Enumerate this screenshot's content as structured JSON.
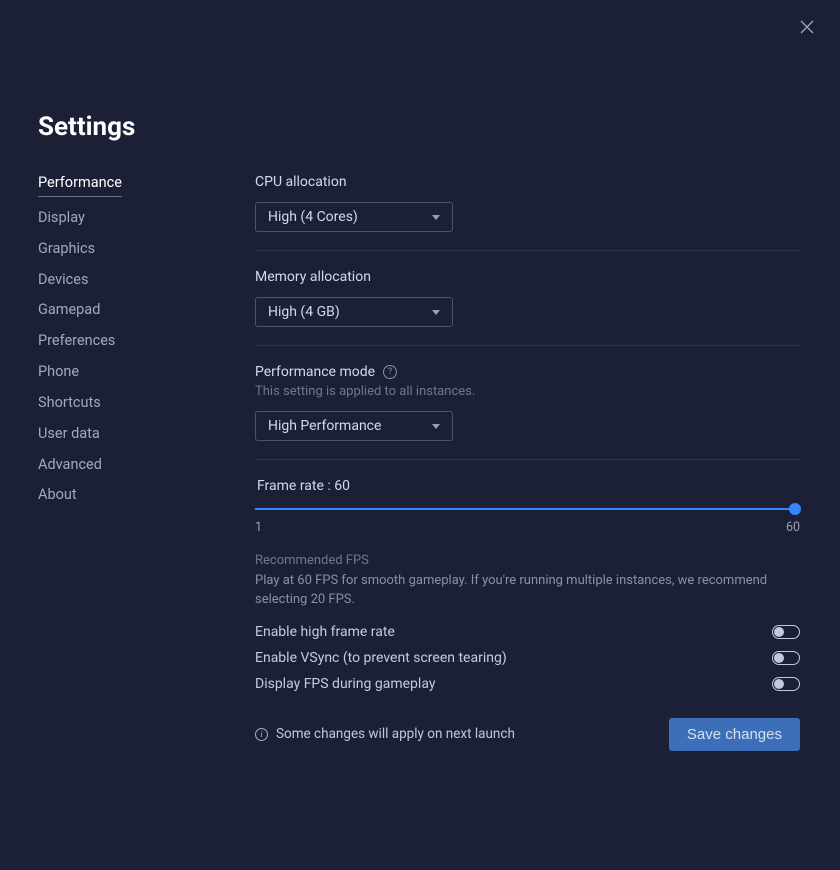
{
  "title": "Settings",
  "sidebar": {
    "items": [
      {
        "label": "Performance"
      },
      {
        "label": "Display"
      },
      {
        "label": "Graphics"
      },
      {
        "label": "Devices"
      },
      {
        "label": "Gamepad"
      },
      {
        "label": "Preferences"
      },
      {
        "label": "Phone"
      },
      {
        "label": "Shortcuts"
      },
      {
        "label": "User data"
      },
      {
        "label": "Advanced"
      },
      {
        "label": "About"
      }
    ],
    "active_index": 0
  },
  "cpu": {
    "label": "CPU allocation",
    "value": "High (4 Cores)"
  },
  "memory": {
    "label": "Memory allocation",
    "value": "High (4 GB)"
  },
  "perf_mode": {
    "label": "Performance mode",
    "hint": "This setting is applied to all instances.",
    "value": "High Performance"
  },
  "frame_rate": {
    "label": "Frame rate : 60",
    "min": "1",
    "max": "60",
    "rec_title": "Recommended FPS",
    "rec_text": "Play at 60 FPS for smooth gameplay. If you're running multiple instances, we recommend selecting 20 FPS."
  },
  "toggles": {
    "high_fr": {
      "label": "Enable high frame rate",
      "on": false
    },
    "vsync": {
      "label": "Enable VSync (to prevent screen tearing)",
      "on": false
    },
    "show_fps": {
      "label": "Display FPS during gameplay",
      "on": false
    }
  },
  "footer": {
    "info": "Some changes will apply on next launch",
    "save": "Save changes"
  }
}
